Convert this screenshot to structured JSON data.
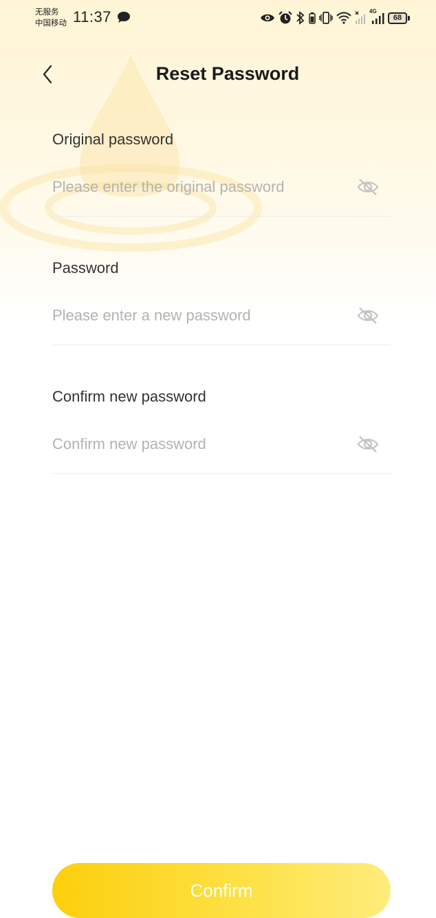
{
  "status_bar": {
    "carrier_line1": "无服务",
    "carrier_line2": "中国移动",
    "time": "11:37",
    "network_label": "4G",
    "battery_level": "68",
    "icons": [
      "message-icon",
      "eye-icon",
      "alarm-icon",
      "bluetooth-icon",
      "vibrate-icon",
      "wifi-icon",
      "signal-icon",
      "battery-icon"
    ]
  },
  "header": {
    "title": "Reset Password",
    "back_icon": "chevron-left-icon"
  },
  "form": {
    "fields": [
      {
        "label": "Original password",
        "placeholder": "Please enter the original password",
        "value": "",
        "toggle_icon": "eye-off-icon"
      },
      {
        "label": "Password",
        "placeholder": "Please enter a new password",
        "value": "",
        "toggle_icon": "eye-off-icon"
      },
      {
        "label": "Confirm new password",
        "placeholder": "Confirm new password",
        "value": "",
        "toggle_icon": "eye-off-icon"
      }
    ]
  },
  "confirm_button": {
    "label": "Confirm"
  },
  "colors": {
    "accent_start": "#fccf0b",
    "accent_end": "#ffec7c",
    "placeholder": "#b3b3b3",
    "label": "#333333"
  }
}
